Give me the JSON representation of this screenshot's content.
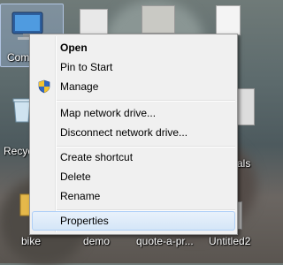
{
  "desktop": {
    "icons": [
      {
        "label": "Comp"
      },
      {
        "label": "Recyc"
      },
      {
        "label": "als"
      },
      {
        "label": "bike"
      },
      {
        "label": "demo"
      },
      {
        "label": "quote-a-pr..."
      },
      {
        "label": "Untitled2"
      }
    ]
  },
  "context_menu": {
    "items": [
      {
        "label": "Open",
        "bold": true
      },
      {
        "label": "Pin to Start"
      },
      {
        "label": "Manage",
        "icon": "uac-shield-icon"
      },
      {
        "label": "Map network drive..."
      },
      {
        "label": "Disconnect network drive..."
      },
      {
        "label": "Create shortcut"
      },
      {
        "label": "Delete"
      },
      {
        "label": "Rename"
      },
      {
        "label": "Properties",
        "highlighted": true
      }
    ]
  },
  "colors": {
    "menu_bg": "#f0f0f0",
    "highlight": "#d5e6f7",
    "highlight_border": "#aecff7"
  }
}
